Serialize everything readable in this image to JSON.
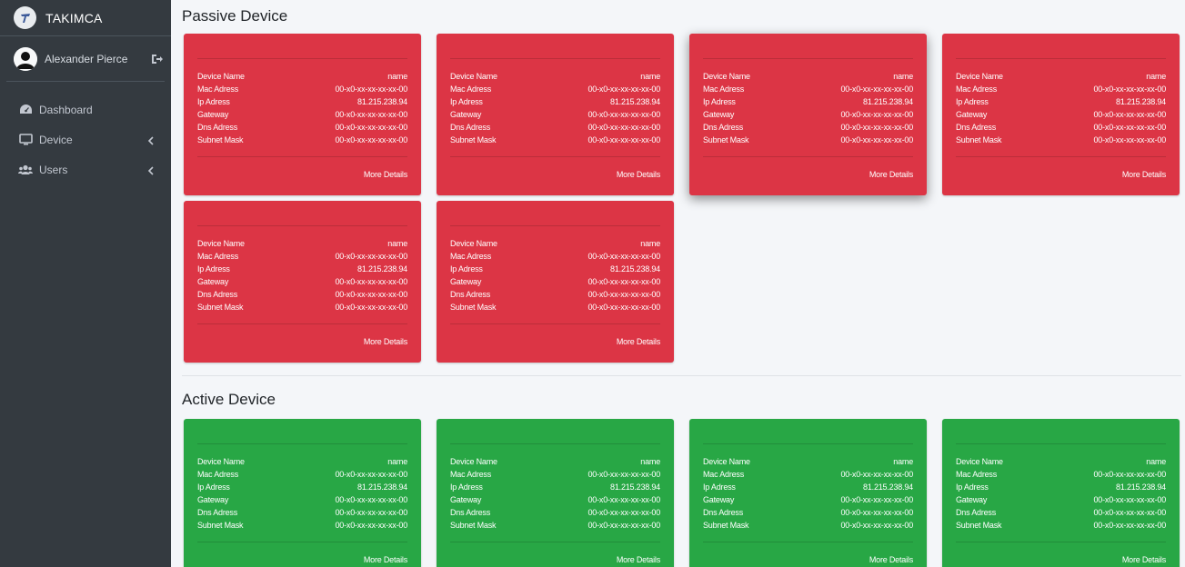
{
  "brand": {
    "name": "TAKIMCA"
  },
  "user": {
    "name": "Alexander Pierce"
  },
  "nav": [
    {
      "label": "Dashboard",
      "icon": "dashboard-icon"
    },
    {
      "label": "Device",
      "icon": "monitor-icon"
    },
    {
      "label": "Users",
      "icon": "users-icon"
    }
  ],
  "sections": {
    "passive_title": "Passive Device",
    "active_title": "Active Device"
  },
  "card_labels": {
    "device_name": "Device Name",
    "mac": "Mac Adress",
    "ip": "Ip Adress",
    "gateway": "Gateway",
    "dns": "Dns Adress",
    "subnet": "Subnet Mask",
    "more": "More Details"
  },
  "passive_devices": [
    {
      "name": "name",
      "mac": "00-x0-xx-xx-xx-xx-00",
      "ip": "81.215.238.94",
      "gateway": "00-x0-xx-xx-xx-xx-00",
      "dns": "00-x0-xx-xx-xx-xx-00",
      "subnet": "00-x0-xx-xx-xx-xx-00"
    },
    {
      "name": "name",
      "mac": "00-x0-xx-xx-xx-xx-00",
      "ip": "81.215.238.94",
      "gateway": "00-x0-xx-xx-xx-xx-00",
      "dns": "00-x0-xx-xx-xx-xx-00",
      "subnet": "00-x0-xx-xx-xx-xx-00"
    },
    {
      "name": "name",
      "mac": "00-x0-xx-xx-xx-xx-00",
      "ip": "81.215.238.94",
      "gateway": "00-x0-xx-xx-xx-xx-00",
      "dns": "00-x0-xx-xx-xx-xx-00",
      "subnet": "00-x0-xx-xx-xx-xx-00"
    },
    {
      "name": "name",
      "mac": "00-x0-xx-xx-xx-xx-00",
      "ip": "81.215.238.94",
      "gateway": "00-x0-xx-xx-xx-xx-00",
      "dns": "00-x0-xx-xx-xx-xx-00",
      "subnet": "00-x0-xx-xx-xx-xx-00"
    },
    {
      "name": "name",
      "mac": "00-x0-xx-xx-xx-xx-00",
      "ip": "81.215.238.94",
      "gateway": "00-x0-xx-xx-xx-xx-00",
      "dns": "00-x0-xx-xx-xx-xx-00",
      "subnet": "00-x0-xx-xx-xx-xx-00"
    },
    {
      "name": "name",
      "mac": "00-x0-xx-xx-xx-xx-00",
      "ip": "81.215.238.94",
      "gateway": "00-x0-xx-xx-xx-xx-00",
      "dns": "00-x0-xx-xx-xx-xx-00",
      "subnet": "00-x0-xx-xx-xx-xx-00"
    }
  ],
  "active_devices": [
    {
      "name": "name",
      "mac": "00-x0-xx-xx-xx-xx-00",
      "ip": "81.215.238.94",
      "gateway": "00-x0-xx-xx-xx-xx-00",
      "dns": "00-x0-xx-xx-xx-xx-00",
      "subnet": "00-x0-xx-xx-xx-xx-00"
    },
    {
      "name": "name",
      "mac": "00-x0-xx-xx-xx-xx-00",
      "ip": "81.215.238.94",
      "gateway": "00-x0-xx-xx-xx-xx-00",
      "dns": "00-x0-xx-xx-xx-xx-00",
      "subnet": "00-x0-xx-xx-xx-xx-00"
    },
    {
      "name": "name",
      "mac": "00-x0-xx-xx-xx-xx-00",
      "ip": "81.215.238.94",
      "gateway": "00-x0-xx-xx-xx-xx-00",
      "dns": "00-x0-xx-xx-xx-xx-00",
      "subnet": "00-x0-xx-xx-xx-xx-00"
    },
    {
      "name": "name",
      "mac": "00-x0-xx-xx-xx-xx-00",
      "ip": "81.215.238.94",
      "gateway": "00-x0-xx-xx-xx-xx-00",
      "dns": "00-x0-xx-xx-xx-xx-00",
      "subnet": "00-x0-xx-xx-xx-xx-00"
    }
  ],
  "colors": {
    "passive": "#dc3545",
    "active": "#28a745",
    "sidebar": "#343a40"
  }
}
